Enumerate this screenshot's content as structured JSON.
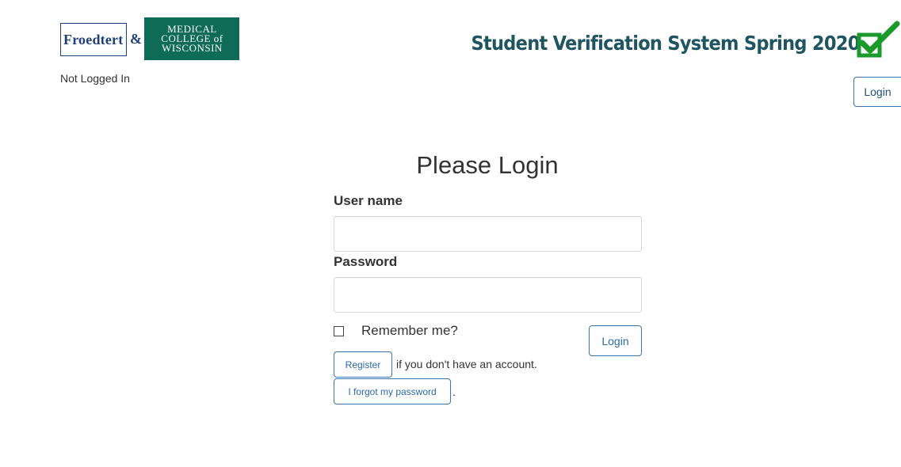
{
  "header": {
    "logo": {
      "left_text": "Froedtert",
      "ampersand": "&",
      "right_line1": "MEDICAL",
      "right_line2": "COLLEGE of",
      "right_line3": "WISCONSIN"
    },
    "login_status": "Not Logged In",
    "app_title": "Student Verification System Spring 2020",
    "login_button_label": "Login"
  },
  "form": {
    "heading": "Please Login",
    "username_label": "User name",
    "username_value": "",
    "password_label": "Password",
    "password_value": "",
    "remember_label": "Remember me?",
    "remember_checked": false,
    "submit_label": "Login",
    "register_label": "Register",
    "register_text": "if you don't have an account.",
    "forgot_label": "I forgot my password",
    "forgot_suffix": "."
  },
  "colors": {
    "title": "#1f5560",
    "logo_green": "#0e6b57",
    "logo_blue": "#1d3f7a",
    "check_green": "#1a9a2a",
    "button_border": "#3a74b3"
  },
  "icons": {
    "title_icon": "checkmark-box-icon"
  }
}
